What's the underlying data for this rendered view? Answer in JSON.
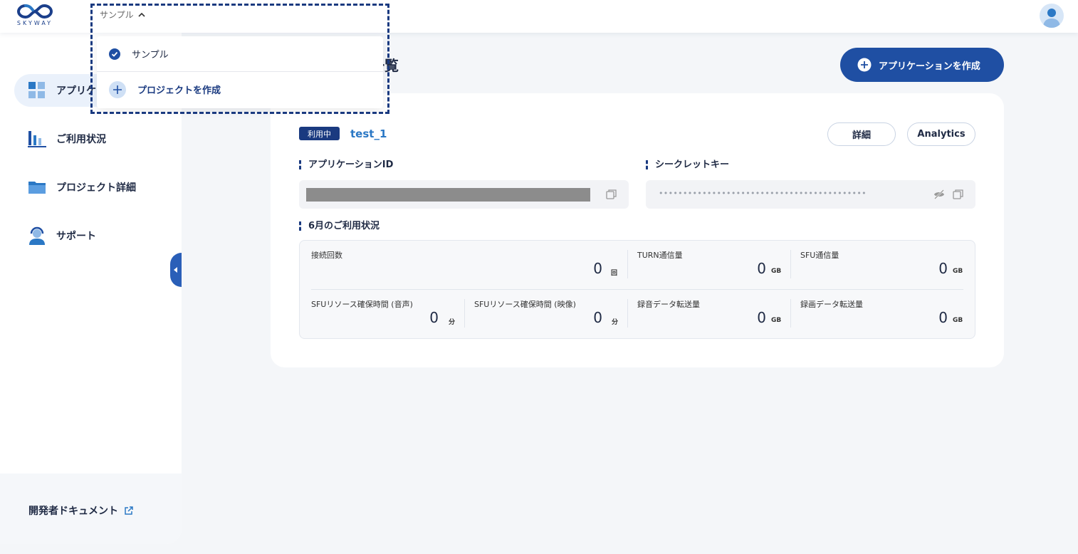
{
  "header": {
    "logo_text": "SKYWAY",
    "project_select": "サンプル",
    "colors": {
      "brand": "#1b3f8b",
      "accent": "#1f4fa3"
    }
  },
  "dropdown": {
    "items": [
      {
        "label": "サンプル",
        "icon": "check-circle-icon"
      },
      {
        "label": "プロジェクトを作成",
        "icon": "plus-icon"
      }
    ]
  },
  "sidebar": {
    "items": [
      {
        "label": "アプリケー",
        "icon": "grid-icon"
      },
      {
        "label": "ご利用状況",
        "icon": "bar-chart-icon"
      },
      {
        "label": "プロジェクト詳細",
        "icon": "folder-icon"
      },
      {
        "label": "サポート",
        "icon": "headset-icon"
      }
    ],
    "footer_link": "開発者ドキュメント"
  },
  "main": {
    "title": "一覧",
    "create_button": "アプリケーションを作成",
    "app": {
      "status": "利用中",
      "name": "test_1",
      "detail_button": "詳細",
      "analytics_button": "Analytics",
      "app_id_label": "アプリケーションID",
      "secret_label": "シークレットキー",
      "secret_mask": "•••••••••••••••••••••••••••••••••••••••••••",
      "usage_label": "6月のご利用状況",
      "stats": [
        {
          "label": "接続回数",
          "value": "0",
          "unit": "回"
        },
        {
          "label": "TURN通信量",
          "value": "0",
          "unit": "GB"
        },
        {
          "label": "SFU通信量",
          "value": "0",
          "unit": "GB"
        },
        {
          "label": "SFUリソース確保時間 (音声)",
          "value": "0",
          "unit": "分"
        },
        {
          "label": "SFUリソース確保時間 (映像)",
          "value": "0",
          "unit": "分"
        },
        {
          "label": "録音データ転送量",
          "value": "0",
          "unit": "GB"
        },
        {
          "label": "録画データ転送量",
          "value": "0",
          "unit": "GB"
        }
      ]
    }
  }
}
